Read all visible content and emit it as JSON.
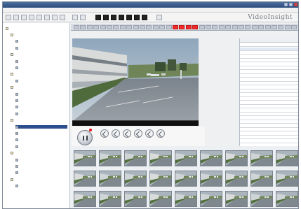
{
  "logo": {
    "text": "VideoInsight"
  },
  "tree": {
    "items": [
      {
        "depth": 0,
        "type": "folder",
        "label": ""
      },
      {
        "depth": 1,
        "type": "folder",
        "label": ""
      },
      {
        "depth": 2,
        "type": "cam",
        "label": ""
      },
      {
        "depth": 2,
        "type": "cam",
        "label": ""
      },
      {
        "depth": 1,
        "type": "folder",
        "label": ""
      },
      {
        "depth": 2,
        "type": "cam",
        "label": ""
      },
      {
        "depth": 2,
        "type": "cam",
        "label": ""
      },
      {
        "depth": 1,
        "type": "folder",
        "label": ""
      },
      {
        "depth": 2,
        "type": "cam",
        "label": ""
      },
      {
        "depth": 1,
        "type": "folder",
        "label": ""
      },
      {
        "depth": 2,
        "type": "cam",
        "label": ""
      },
      {
        "depth": 2,
        "type": "cam",
        "label": ""
      },
      {
        "depth": 2,
        "type": "cam",
        "label": ""
      },
      {
        "depth": 2,
        "type": "cam",
        "label": ""
      },
      {
        "depth": 1,
        "type": "folder",
        "label": ""
      },
      {
        "depth": 2,
        "type": "cam",
        "label": "",
        "selected": true
      },
      {
        "depth": 2,
        "type": "cam",
        "label": ""
      },
      {
        "depth": 2,
        "type": "cam",
        "label": ""
      },
      {
        "depth": 2,
        "type": "cam",
        "label": ""
      },
      {
        "depth": 1,
        "type": "folder",
        "label": ""
      },
      {
        "depth": 2,
        "type": "cam",
        "label": ""
      },
      {
        "depth": 2,
        "type": "cam",
        "label": ""
      },
      {
        "depth": 2,
        "type": "cam",
        "label": ""
      },
      {
        "depth": 1,
        "type": "folder",
        "label": ""
      },
      {
        "depth": 2,
        "type": "cam",
        "label": ""
      }
    ]
  },
  "timeline": {
    "ticks": [
      {
        "red": false
      },
      {
        "red": false
      },
      {
        "red": false
      },
      {
        "red": false
      },
      {
        "red": false
      },
      {
        "red": false
      },
      {
        "red": false
      },
      {
        "red": false
      },
      {
        "red": false
      },
      {
        "red": false
      },
      {
        "red": false
      },
      {
        "red": false
      },
      {
        "red": false
      },
      {
        "red": false
      },
      {
        "red": false
      },
      {
        "red": true
      },
      {
        "red": true
      },
      {
        "red": true
      },
      {
        "red": true
      },
      {
        "red": false
      },
      {
        "red": false
      },
      {
        "red": false
      },
      {
        "red": false
      },
      {
        "red": false
      },
      {
        "red": false
      },
      {
        "red": false
      },
      {
        "red": false
      },
      {
        "red": false
      },
      {
        "red": false
      },
      {
        "red": false
      },
      {
        "red": false
      },
      {
        "red": false
      },
      {
        "red": false
      },
      {
        "red": false
      }
    ]
  },
  "list": {
    "rows": [
      {
        "selected": false
      },
      {
        "selected": true
      },
      {
        "selected": false
      },
      {
        "selected": false
      },
      {
        "selected": false
      },
      {
        "selected": false
      },
      {
        "selected": false
      },
      {
        "selected": false
      },
      {
        "selected": false
      },
      {
        "selected": false
      },
      {
        "selected": false
      },
      {
        "selected": false
      },
      {
        "selected": false
      },
      {
        "selected": false
      },
      {
        "selected": false
      },
      {
        "selected": false
      },
      {
        "selected": false
      },
      {
        "selected": false
      },
      {
        "selected": false
      },
      {
        "selected": false
      },
      {
        "selected": false
      },
      {
        "selected": false
      },
      {
        "selected": false
      },
      {
        "selected": false
      },
      {
        "selected": false
      },
      {
        "selected": false
      },
      {
        "selected": false
      }
    ]
  },
  "thumbs": {
    "count": 27
  },
  "colors": {
    "accent_red": "#ef2a2a",
    "titlebar": "#2b4b7c",
    "selected": "#2d4f8e"
  },
  "icons": {
    "toolbar": [
      "app-icon",
      "back-icon",
      "forward-icon",
      "layout-1-icon",
      "layout-4-icon",
      "layout-9-icon",
      "layout-16-icon",
      "fullscreen-icon",
      "settings-icon",
      "search-icon",
      "export-icon"
    ],
    "controls": [
      "rewind-icon",
      "step-back-icon",
      "play-icon",
      "step-forward-icon",
      "fast-forward-icon",
      "loop-icon"
    ]
  }
}
